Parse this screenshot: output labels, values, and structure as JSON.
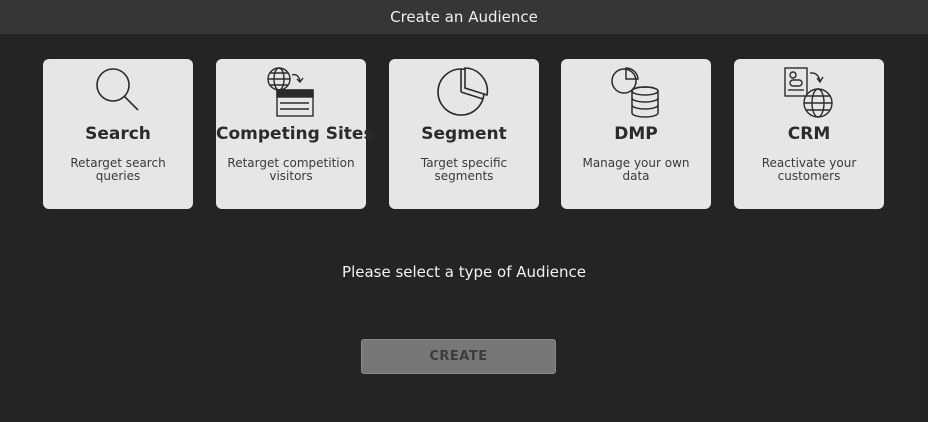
{
  "window": {
    "title": "Create an Audience"
  },
  "cards": [
    {
      "icon": "search-icon",
      "title": "Search",
      "description": "Retarget search queries"
    },
    {
      "icon": "competing-sites-icon",
      "title": "Competing Sites",
      "description": "Retarget competition visitors"
    },
    {
      "icon": "pie-chart-icon",
      "title": "Segment",
      "description": "Target specific segments"
    },
    {
      "icon": "database-icon",
      "title": "DMP",
      "description": "Manage your own data"
    },
    {
      "icon": "crm-icon",
      "title": "CRM",
      "description": "Reactivate your customers"
    }
  ],
  "prompt": "Please select a type of Audience",
  "create_button": {
    "label": "CREATE"
  },
  "colors": {
    "background": "#242424",
    "title_bar": "#363636",
    "card": "#e6e6e6",
    "button_disabled": "#777777"
  }
}
